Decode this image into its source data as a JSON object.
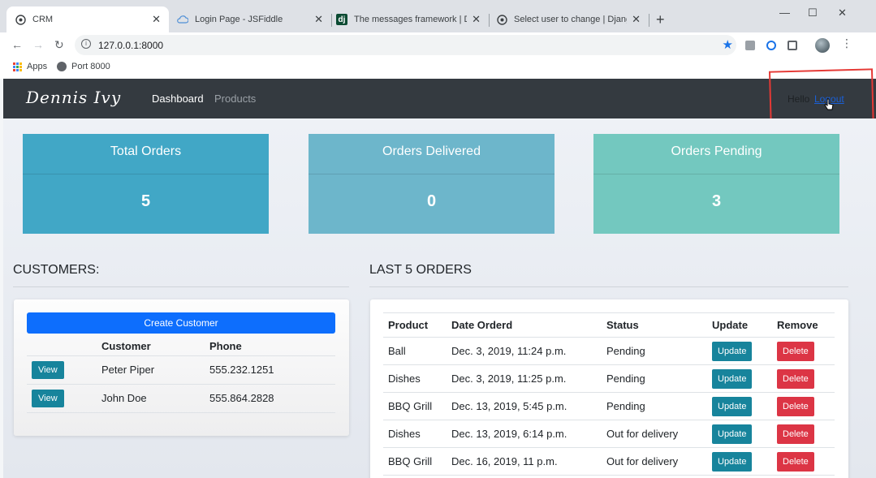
{
  "browser": {
    "tabs": [
      {
        "title": "CRM",
        "icon": "globe-icon",
        "active": true
      },
      {
        "title": "Login Page - JSFiddle",
        "icon": "cloud-icon"
      },
      {
        "title": "The messages framework | Djang",
        "icon": "django-icon"
      },
      {
        "title": "Select user to change | Django si",
        "icon": "globe-icon"
      }
    ],
    "new_tab": "+",
    "url": "127.0.0.1:8000",
    "bookmarks": [
      {
        "label": "Apps",
        "icon": "apps-grid-icon"
      },
      {
        "label": "Port 8000",
        "icon": "globe-icon"
      }
    ]
  },
  "navbar": {
    "brand": "Dennis Ivy",
    "links": [
      {
        "label": "Dashboard",
        "active": true
      },
      {
        "label": "Products",
        "active": false
      }
    ],
    "greeting": "Hello",
    "logout": "Logout"
  },
  "stats": [
    {
      "label": "Total Orders",
      "value": "5",
      "color": "#41a7c6"
    },
    {
      "label": "Orders Delivered",
      "value": "0",
      "color": "#6db6cb"
    },
    {
      "label": "Orders Pending",
      "value": "3",
      "color": "#73c8bf"
    }
  ],
  "customers": {
    "title": "CUSTOMERS:",
    "create_label": "Create Customer",
    "headers": [
      "",
      "Customer",
      "Phone"
    ],
    "view_label": "View",
    "rows": [
      {
        "name": "Peter Piper",
        "phone": "555.232.1251"
      },
      {
        "name": "John Doe",
        "phone": "555.864.2828"
      }
    ]
  },
  "orders": {
    "title": "LAST 5 ORDERS",
    "headers": [
      "Product",
      "Date Orderd",
      "Status",
      "Update",
      "Remove"
    ],
    "update_label": "Update",
    "delete_label": "Delete",
    "rows": [
      {
        "product": "Ball",
        "date": "Dec. 3, 2019, 11:24 p.m.",
        "status": "Pending"
      },
      {
        "product": "Dishes",
        "date": "Dec. 3, 2019, 11:25 p.m.",
        "status": "Pending"
      },
      {
        "product": "BBQ Grill",
        "date": "Dec. 13, 2019, 5:45 p.m.",
        "status": "Pending"
      },
      {
        "product": "Dishes",
        "date": "Dec. 13, 2019, 6:14 p.m.",
        "status": "Out for delivery"
      },
      {
        "product": "BBQ Grill",
        "date": "Dec. 16, 2019, 11 p.m.",
        "status": "Out for delivery"
      }
    ]
  }
}
